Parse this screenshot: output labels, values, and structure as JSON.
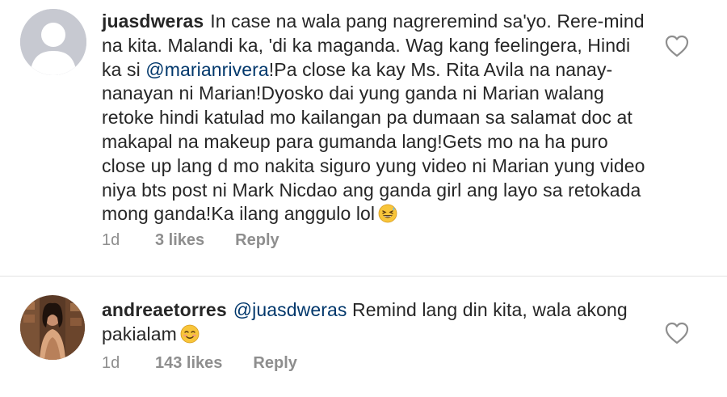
{
  "comments": [
    {
      "username": "juasdweras",
      "text_before_mention": "In case na wala pang nagreremind sa'yo. Rere-mind na kita. Malandi ka, 'di ka maganda. Wag kang feelingera, Hindi ka si ",
      "mention": "@marianrivera",
      "text_after_mention": "!Pa close ka kay Ms. Rita Avila na nanay-nanayan ni Marian!Dyosko dai yung ganda ni Marian walang retoke hindi katulad mo kailangan pa dumaan sa salamat doc at makapal na makeup para gumanda lang!Gets mo na ha puro close up lang d mo nakita siguro yung video ni Marian yung video niya bts post ni Mark Nicdao ang ganda girl ang layo sa retokada mong ganda!Ka ilang anggulo lol",
      "emoji": "grinning-squinting-sweat-face",
      "age": "1d",
      "likes": "3 likes",
      "reply": "Reply"
    },
    {
      "username": "andreaetorres",
      "mention": "@juasdweras",
      "text_after_mention": " Remind lang din kita, wala akong pakialam",
      "emoji": "smiling-blush-face",
      "age": "1d",
      "likes": "143 likes",
      "reply": "Reply"
    }
  ],
  "colors": {
    "text": "#262626",
    "mention": "#00376b",
    "meta": "#8e8e8e",
    "divider": "#e3e3e3",
    "emoji_yellow": "#f8c53a"
  }
}
